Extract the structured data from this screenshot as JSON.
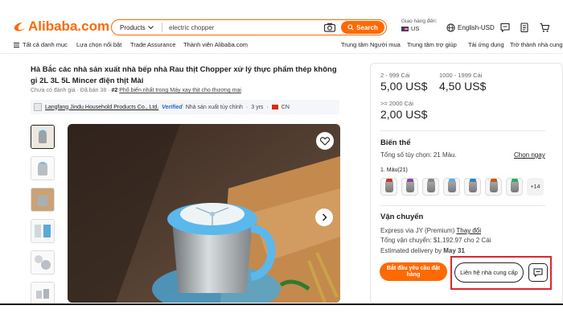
{
  "header": {
    "logo_text": "Alibaba.com",
    "search": {
      "category": "Products",
      "value": "electric chopper",
      "button_label": "Search"
    },
    "deliver_to_label": "Giao hàng đến:",
    "country": "US",
    "language_currency": "English-USD"
  },
  "nav": {
    "left": [
      "Tất cả danh mục",
      "Lựa chọn nổi bật",
      "Trade Assurance",
      "Thành viên Alibaba.com"
    ],
    "right": [
      "Trung tâm Người mua",
      "Trung tâm trợ giúp",
      "Tải ứng dụng",
      "Trở thành nhà cung cấp"
    ]
  },
  "product": {
    "title": "Hà Bắc các nhà sản xuất nhà bếp nhà Rau thịt Chopper xử lý thực phẩm thép không gỉ 2L 3L 5L Mincer điện thịt Mài",
    "reviews": "Chưa có đánh giá",
    "sold": "Đã bán 38",
    "rank": "#2",
    "rank_text": "Phổ biến nhất trong Máy xay thịt cho thương mại",
    "supplier_name": "Langfang Jindu Household Products Co., Ltd.",
    "verified": "Verified",
    "supplier_type": "Nhà sản xuất tùy chỉnh",
    "years": "3 yrs",
    "country": "CN"
  },
  "pricing": {
    "tiers": [
      {
        "range": "2 - 999 Cái",
        "price": "5,00 US$"
      },
      {
        "range": "1000 - 1999 Cái",
        "price": "4,50 US$"
      },
      {
        "range": ">= 2000 Cái",
        "price": "2,00 US$"
      }
    ]
  },
  "variants": {
    "title": "Biến thể",
    "total": "Tổng số tùy chọn: 21 Màu.",
    "select_link": "Chọn ngay",
    "color_label": "1. Màu(21)",
    "more_count": "+14",
    "swatch_colors": [
      "#c0392b",
      "#8e44ad",
      "#7f8c8d",
      "#5dade2",
      "#2e86c1",
      "#d35400",
      "#27ae60"
    ]
  },
  "shipping": {
    "title": "Vận chuyển",
    "method_text": "Express via JY (Premium)",
    "change_link": "Thay đổi",
    "total_text": "Tổng vận chuyển: $1,192.97 cho 2 Cái",
    "delivery_label": "Estimated delivery by",
    "delivery_date": "May 31"
  },
  "actions": {
    "order_button": "Bắt đầu yêu cầu đặt hàng",
    "contact_button": "Liên hệ nhà cung cấp"
  },
  "colors": {
    "accent": "#ff6a00",
    "highlight": "#e0262d",
    "verified": "#1f66d1"
  }
}
